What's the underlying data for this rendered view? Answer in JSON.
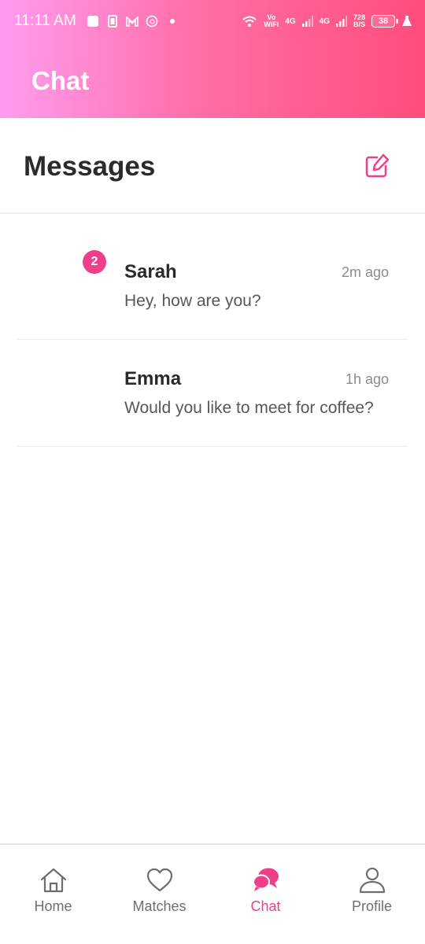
{
  "status_bar": {
    "time": "11:11 AM",
    "vowifi_top": "Vo",
    "vowifi_bottom": "WiFi",
    "sim1": "4G",
    "sim2": "4G",
    "speed_top": "728",
    "speed_bottom": "B/S",
    "battery": "38"
  },
  "header": {
    "title": "Chat"
  },
  "messages": {
    "title": "Messages",
    "items": [
      {
        "name": "Sarah",
        "time": "2m ago",
        "preview": "Hey, how are you?",
        "unread": "2"
      },
      {
        "name": "Emma",
        "time": "1h ago",
        "preview": "Would you like to meet for coffee?"
      }
    ]
  },
  "nav": {
    "items": [
      {
        "label": "Home",
        "icon": "home-icon"
      },
      {
        "label": "Matches",
        "icon": "heart-icon"
      },
      {
        "label": "Chat",
        "icon": "chat-icon",
        "active": true
      },
      {
        "label": "Profile",
        "icon": "user-icon"
      }
    ]
  },
  "colors": {
    "accent": "#f03f8a",
    "gradient_start": "#ff9cf0",
    "gradient_end": "#ff4d7b"
  }
}
